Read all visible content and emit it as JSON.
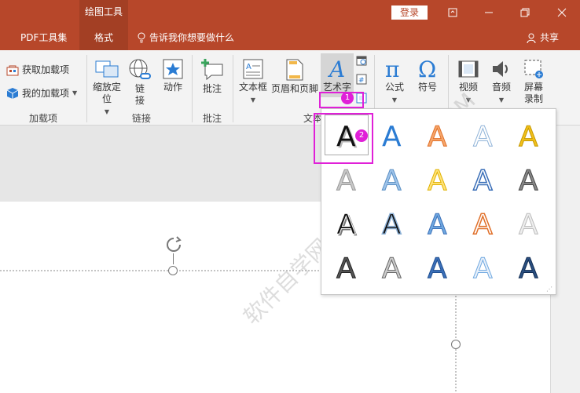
{
  "titlebar": {
    "context_tab": "绘图工具",
    "login": "登录"
  },
  "tabs": [
    {
      "label": "PDF工具集"
    },
    {
      "label": "格式"
    }
  ],
  "tell_me": "告诉我你想要做什么",
  "share": "共享",
  "ribbon": {
    "addins": {
      "get": "获取加载项",
      "mine": "我的加载项",
      "label": "加载项"
    },
    "links": {
      "zoom": "缩放定位",
      "link": "链接",
      "action": "动作",
      "label": "链接"
    },
    "comments": {
      "comment": "批注",
      "label": "批注"
    },
    "text": {
      "textbox": "文本框",
      "header": "页眉和页脚",
      "wordart": "艺术字",
      "label": "文本"
    },
    "symbols": {
      "equation": "公式",
      "symbol": "符号"
    },
    "media": {
      "video": "视频",
      "audio": "音频",
      "record": "屏幕录制"
    }
  },
  "gallery": {
    "glyph": "A",
    "rows": 4,
    "cols": 5
  },
  "badges": [
    "1",
    "2"
  ],
  "watermark": "软件自学网 WWW.RJZXW.COM",
  "colors": {
    "accent": "#b7472a",
    "highlight": "#e020d8"
  }
}
